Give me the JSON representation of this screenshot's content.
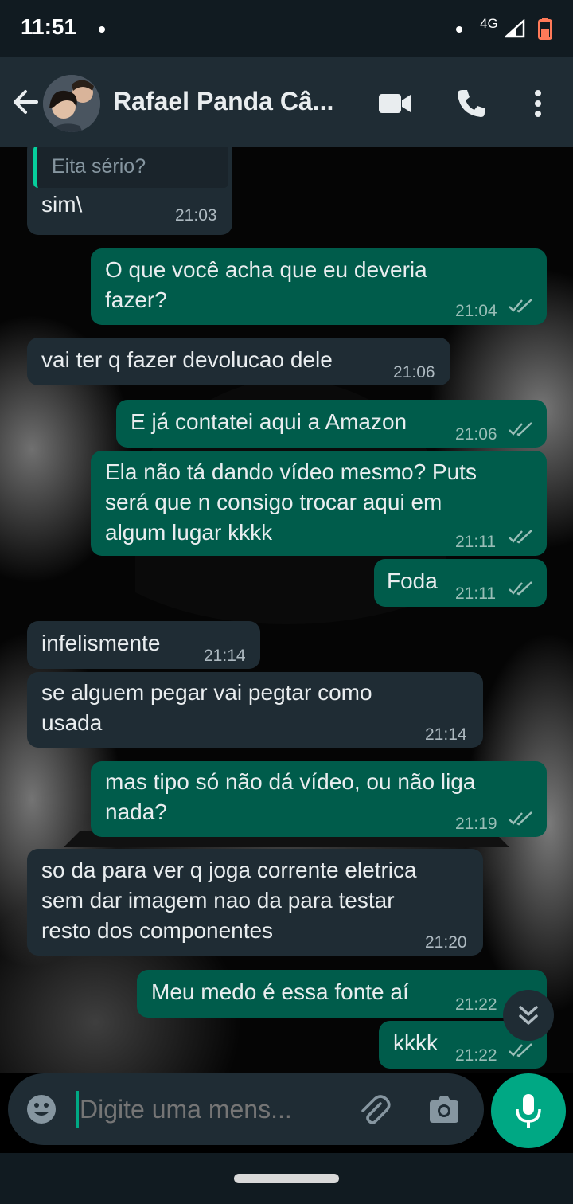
{
  "status_bar": {
    "time": "11:51",
    "network": "4G"
  },
  "header": {
    "contact_name": "Rafael Panda Câ..."
  },
  "messages": [
    {
      "dir": "in",
      "quote": "Eita sério?",
      "text": "sim\\",
      "time": "21:03"
    },
    {
      "dir": "out",
      "text": "O que você acha que eu deveria\nfazer?",
      "time": "21:04"
    },
    {
      "dir": "in",
      "text": "vai ter q fazer devolucao dele",
      "time": "21:06"
    },
    {
      "dir": "out",
      "text": "E já contatei aqui a Amazon",
      "time": "21:06"
    },
    {
      "dir": "out",
      "text": "Ela não tá dando vídeo mesmo? Puts\nserá que n consigo trocar aqui em\nalgum lugar kkkk",
      "time": "21:11"
    },
    {
      "dir": "out",
      "text": "Foda",
      "time": "21:11"
    },
    {
      "dir": "in",
      "text": "infelismente",
      "time": "21:14"
    },
    {
      "dir": "in",
      "text": "se alguem pegar vai pegtar como\nusada",
      "time": "21:14"
    },
    {
      "dir": "out",
      "text": "mas tipo só não dá vídeo, ou não liga\nnada?",
      "time": "21:19"
    },
    {
      "dir": "in",
      "text": "so da para ver q joga corrente eletrica\nsem dar imagem nao da para testar\nresto dos componentes",
      "time": "21:20"
    },
    {
      "dir": "out",
      "text": "Meu medo é essa fonte aí",
      "time": "21:22"
    },
    {
      "dir": "out",
      "text": "kkkk",
      "time": "21:22"
    }
  ],
  "composer": {
    "placeholder": "Digite uma mens..."
  },
  "colors": {
    "incoming": "#1f2c34",
    "outgoing": "#005c4b",
    "accent": "#00a884",
    "read_ticks": "#99beb7"
  },
  "icons": [
    "back-arrow-icon",
    "video-call-icon",
    "phone-icon",
    "more-vert-icon",
    "emoji-icon",
    "attach-icon",
    "camera-icon",
    "mic-icon",
    "double-chevron-down-icon"
  ]
}
